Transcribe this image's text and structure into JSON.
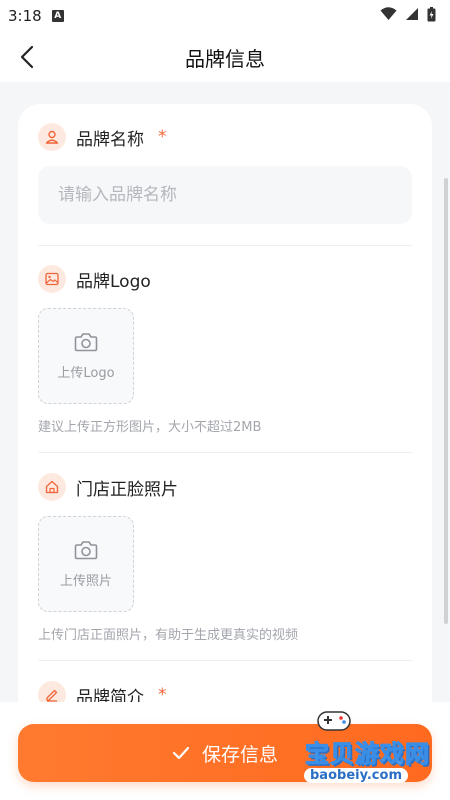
{
  "status_bar": {
    "time": "3:18",
    "notification_letter": "A"
  },
  "nav": {
    "title": "品牌信息"
  },
  "brand_name": {
    "label": "品牌名称",
    "required_mark": "*",
    "placeholder": "请输入品牌名称",
    "value": ""
  },
  "brand_logo": {
    "label": "品牌Logo",
    "upload_label": "上传Logo",
    "hint": "建议上传正方形图片，大小不超过2MB"
  },
  "store_photo": {
    "label": "门店正脸照片",
    "upload_label": "上传照片",
    "hint": "上传门店正面照片，有助于生成更真实的视频"
  },
  "brand_intro": {
    "label": "品牌简介",
    "required_mark": "*"
  },
  "save_button": {
    "label": "保存信息"
  },
  "watermark": {
    "title": "宝贝游戏网",
    "url": "baobeiy.com"
  },
  "colors": {
    "accent": "#ff6f26",
    "icon_bg": "#fde9df",
    "icon_fg": "#f0663a"
  }
}
